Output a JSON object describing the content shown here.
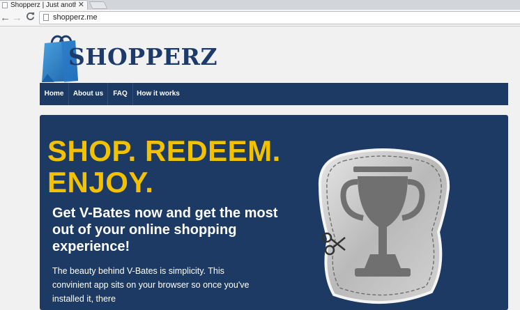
{
  "browser": {
    "tab_title": "Shopperz | Just another W",
    "tab_close": "✕",
    "url": "shopperz.me",
    "back_icon": "←",
    "forward_icon": "→",
    "reload_icon": "C"
  },
  "site": {
    "logo_text": "SHOPPERZ",
    "nav": [
      "Home",
      "About us",
      "FAQ",
      "How it works"
    ],
    "hero": {
      "headline_line1": "SHOP. REDEEM.",
      "headline_line2": "ENJOY.",
      "subheadline": "Get V-Bates now and get the most out of your online shopping experience!",
      "body": "The beauty behind V-Bates is simplicity. This convinient app sits on your browser so once you've installed it, there"
    }
  },
  "colors": {
    "navy": "#1c3a63",
    "headline_yellow": "#f2c200",
    "logo_blue": "#1c3a6a"
  },
  "icons": [
    "back-arrow-icon",
    "forward-arrow-icon",
    "reload-icon",
    "page-icon",
    "shopping-bag-icon",
    "trophy-coupon-icon",
    "scissors-icon"
  ]
}
